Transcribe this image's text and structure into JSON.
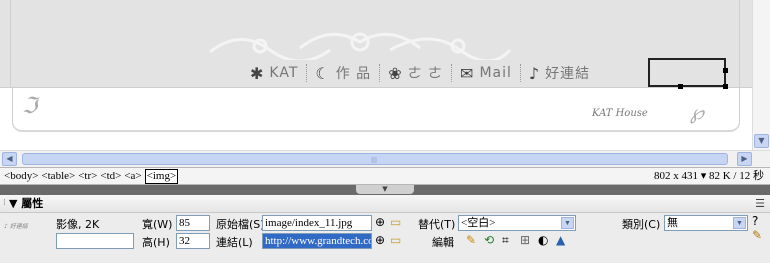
{
  "design_view": {
    "nav_items": [
      {
        "icon": "flower-icon",
        "glyph": "✱",
        "label": "KAT"
      },
      {
        "icon": "moon-icon",
        "glyph": "☾",
        "label": "作 品"
      },
      {
        "icon": "paw-icon",
        "glyph": "❀",
        "label": "ㄜ ㄜ"
      },
      {
        "icon": "envelope-icon",
        "glyph": "✉",
        "label": "Mail"
      },
      {
        "icon": "music-note-icon",
        "glyph": "♪",
        "label": "好連結"
      }
    ],
    "footer_brand": "KAT House"
  },
  "status_bar": {
    "tags": [
      "<body>",
      "<table>",
      "<tr>",
      "<td>",
      "<a>",
      "<img>"
    ],
    "selected_tag": "<img>",
    "doc_size": "802 x 431 ▾ 82 K / 12 秒"
  },
  "property_inspector": {
    "title": "▼ 屬性",
    "element_type": "影像, 2K",
    "width_label": "寬(W)",
    "width_value": "85",
    "height_label": "高(H)",
    "height_value": "32",
    "src_label": "原始檔(S)",
    "src_value": "image/index_11.jpg",
    "link_label": "連結(L)",
    "link_value": "http://www.grandtech.co",
    "alt_label": "替代(T)",
    "alt_value": "<空白>",
    "class_label": "類別(C)",
    "class_value": "無",
    "edit_label": "編輯"
  },
  "colors": {
    "selection": "#316ac5",
    "scroll_accent": "#c8d6f4"
  }
}
